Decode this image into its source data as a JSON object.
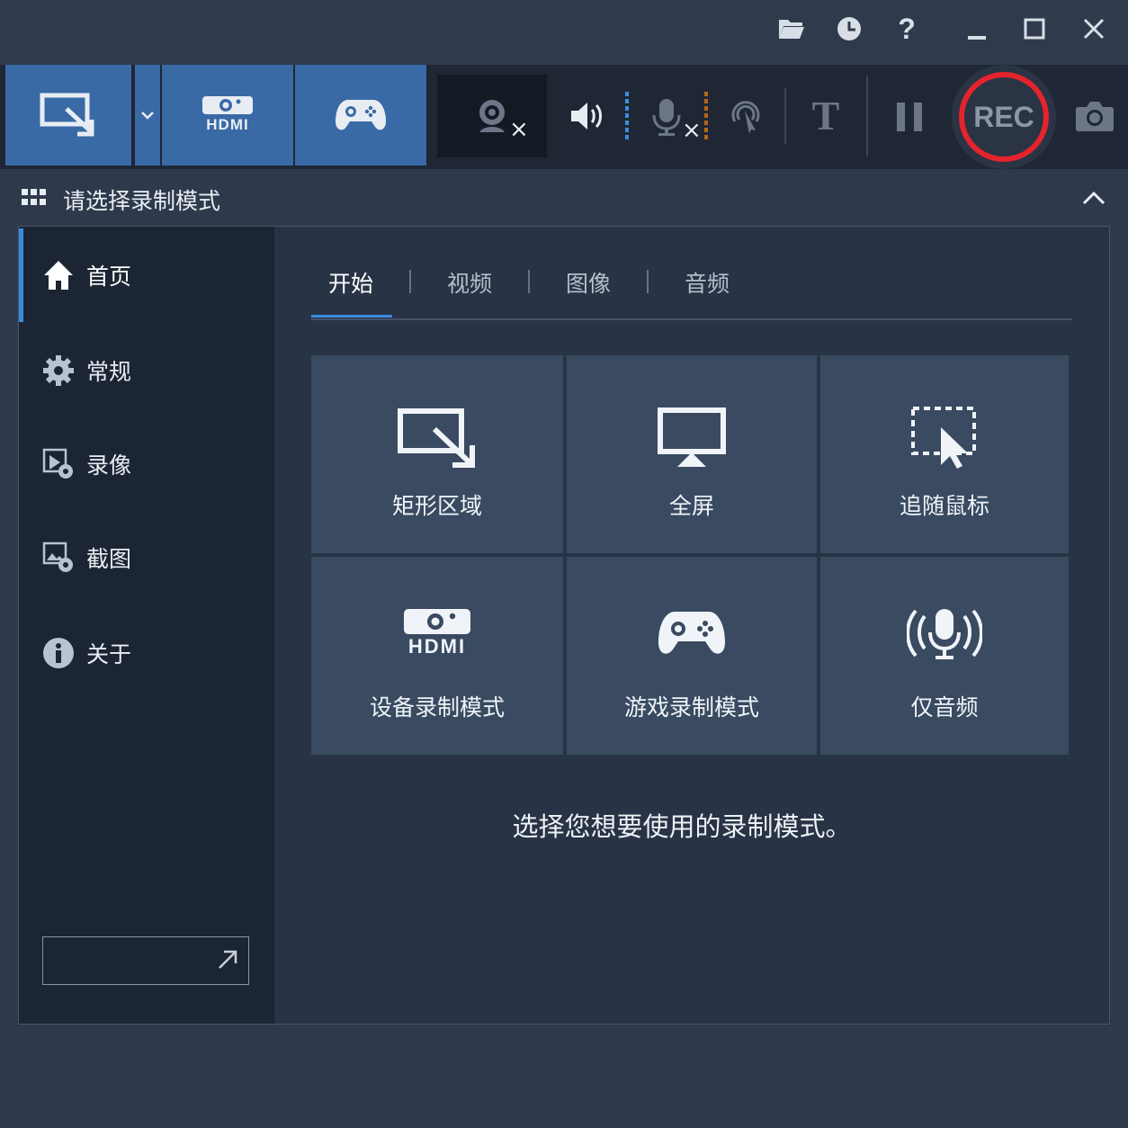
{
  "window": {
    "controls": [
      "folder-icon",
      "history-icon",
      "help-icon",
      "minimize-icon",
      "maximize-icon",
      "close-icon"
    ],
    "help_glyph": "?"
  },
  "toolbar": {
    "modes": [
      {
        "name": "rectangle-mode",
        "icon": "rectangle-area-icon"
      },
      {
        "name": "mode-dropdown",
        "icon": "chevron-down-icon"
      },
      {
        "name": "hdmi-mode",
        "icon": "hdmi-icon",
        "text": "HDMI"
      },
      {
        "name": "game-mode",
        "icon": "gamepad-icon"
      }
    ],
    "webcam_off_mark": "×",
    "mic_off_mark": "×",
    "text_tool": "T",
    "rec_label": "REC",
    "colors": {
      "accent": "#3a6aa6",
      "rec_ring": "#e4242c",
      "audio_level": "#3a8be0",
      "mic_level": "#b5651d"
    }
  },
  "section": {
    "title": "请选择录制模式"
  },
  "sidebar": {
    "items": [
      {
        "label": "首页",
        "icon": "home-icon",
        "active": true
      },
      {
        "label": "常规",
        "icon": "gear-icon",
        "active": false
      },
      {
        "label": "录像",
        "icon": "video-settings-icon",
        "active": false
      },
      {
        "label": "截图",
        "icon": "screenshot-settings-icon",
        "active": false
      },
      {
        "label": "关于",
        "icon": "info-icon",
        "active": false
      }
    ],
    "search": {
      "value": "",
      "placeholder": ""
    }
  },
  "tabs": [
    {
      "label": "开始",
      "active": true
    },
    {
      "label": "视频",
      "active": false
    },
    {
      "label": "图像",
      "active": false
    },
    {
      "label": "音频",
      "active": false
    }
  ],
  "tiles": [
    {
      "label": "矩形区域",
      "icon": "rectangle-area-icon"
    },
    {
      "label": "全屏",
      "icon": "monitor-icon"
    },
    {
      "label": "追随鼠标",
      "icon": "follow-mouse-icon"
    },
    {
      "label": "设备录制模式",
      "icon": "hdmi-icon",
      "text": "HDMI"
    },
    {
      "label": "游戏录制模式",
      "icon": "gamepad-icon"
    },
    {
      "label": "仅音频",
      "icon": "microphone-icon"
    }
  ],
  "hint": "选择您想要使用的录制模式。"
}
